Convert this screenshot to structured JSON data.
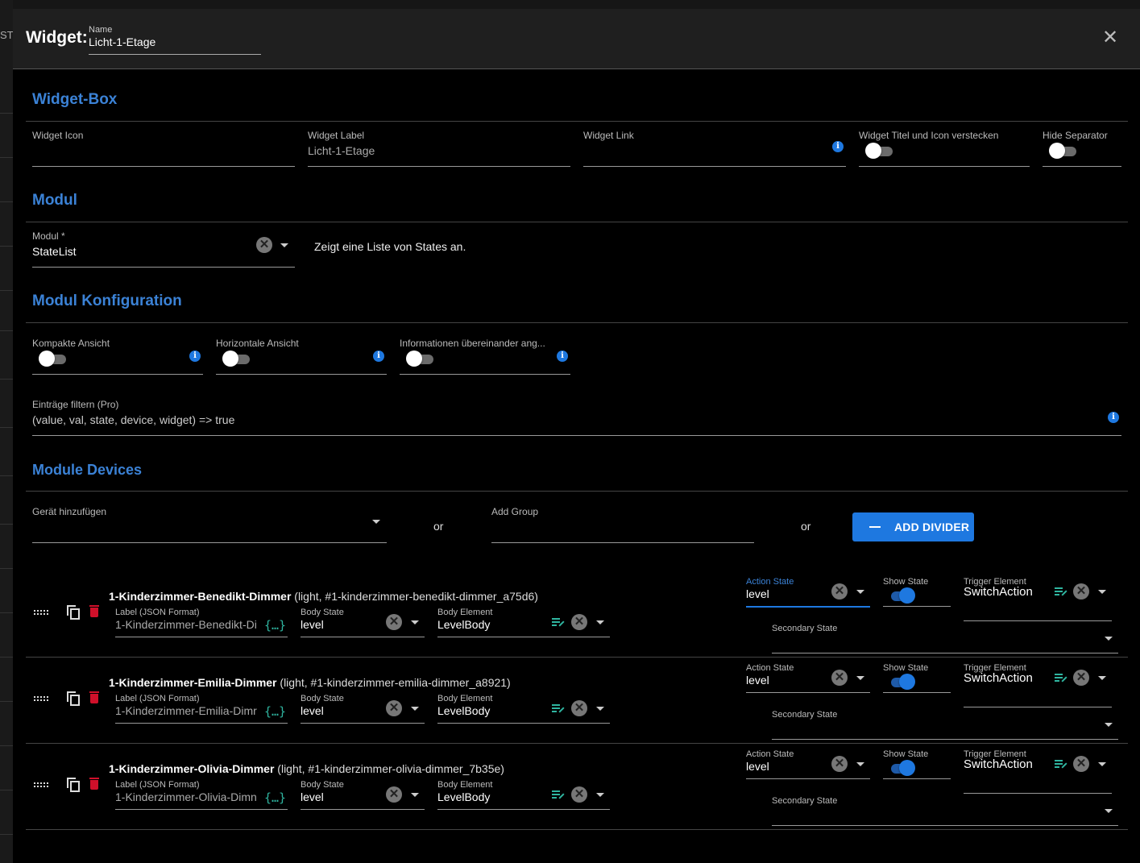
{
  "background": {
    "partial_text": "STY"
  },
  "dialog": {
    "title": "Widget:",
    "name_field": {
      "label": "Name",
      "value": "Licht-1-Etage"
    },
    "close_icon": "close-icon"
  },
  "sections": {
    "widget_box": {
      "title": "Widget-Box",
      "widget_icon": {
        "label": "Widget Icon",
        "value": ""
      },
      "widget_label": {
        "label": "Widget Label",
        "value": "Licht-1-Etage"
      },
      "widget_link": {
        "label": "Widget Link",
        "value": ""
      },
      "hide_title_icon": {
        "label": "Widget Titel und Icon verstecken",
        "checked": false
      },
      "hide_separator": {
        "label": "Hide Separator",
        "checked": false
      }
    },
    "modul": {
      "title": "Modul",
      "modul_select": {
        "label": "Modul *",
        "value": "StateList"
      },
      "description": "Zeigt eine Liste von States an."
    },
    "modul_config": {
      "title": "Modul Konfiguration",
      "kompakte": {
        "label": "Kompakte Ansicht",
        "checked": false
      },
      "horizontale": {
        "label": "Horizontale Ansicht",
        "checked": false
      },
      "informationen": {
        "label": "Informationen übereinander ang...",
        "checked": false
      },
      "filter": {
        "label": "Einträge filtern (Pro)",
        "value": "(value, val, state, device, widget) => true"
      }
    },
    "module_devices": {
      "title": "Module Devices",
      "add_device": {
        "label": "Gerät hinzufügen",
        "value": ""
      },
      "or_1": "or",
      "add_group": {
        "label": "Add Group",
        "value": ""
      },
      "or_2": "or",
      "add_divider_label": "ADD DIVIDER"
    }
  },
  "devices": [
    {
      "name": "1-Kinderzimmer-Benedikt-Dimmer",
      "meta": "(light, #1-kinderzimmer-benedikt-dimmer_a75d6)",
      "label_field": {
        "label": "Label (JSON Format)",
        "value": "1-Kinderzimmer-Benedikt-Di"
      },
      "body_state": {
        "label": "Body State",
        "value": "level"
      },
      "body_element": {
        "label": "Body Element",
        "value": "LevelBody"
      },
      "action_state": {
        "label": "Action State",
        "value": "level"
      },
      "show_state": {
        "label": "Show State",
        "checked": true
      },
      "trigger_element": {
        "label": "Trigger Element",
        "value": "SwitchAction"
      },
      "secondary_state": {
        "label": "Secondary State",
        "value": ""
      }
    },
    {
      "name": "1-Kinderzimmer-Emilia-Dimmer",
      "meta": "(light, #1-kinderzimmer-emilia-dimmer_a8921)",
      "label_field": {
        "label": "Label (JSON Format)",
        "value": "1-Kinderzimmer-Emilia-Dimr"
      },
      "body_state": {
        "label": "Body State",
        "value": "level"
      },
      "body_element": {
        "label": "Body Element",
        "value": "LevelBody"
      },
      "action_state": {
        "label": "Action State",
        "value": "level"
      },
      "show_state": {
        "label": "Show State",
        "checked": true
      },
      "trigger_element": {
        "label": "Trigger Element",
        "value": "SwitchAction"
      },
      "secondary_state": {
        "label": "Secondary State",
        "value": ""
      }
    },
    {
      "name": "1-Kinderzimmer-Olivia-Dimmer",
      "meta": "(light, #1-kinderzimmer-olivia-dimmer_7b35e)",
      "label_field": {
        "label": "Label (JSON Format)",
        "value": "1-Kinderzimmer-Olivia-Dimn"
      },
      "body_state": {
        "label": "Body State",
        "value": "level"
      },
      "body_element": {
        "label": "Body Element",
        "value": "LevelBody"
      },
      "action_state": {
        "label": "Action State",
        "value": "level"
      },
      "show_state": {
        "label": "Show State",
        "checked": true
      },
      "trigger_element": {
        "label": "Trigger Element",
        "value": "SwitchAction"
      },
      "secondary_state": {
        "label": "Secondary State",
        "value": ""
      }
    }
  ],
  "colors": {
    "accent": "#1e78e0",
    "section_title": "#3b82d6",
    "json_icon": "#2fb5a0",
    "delete": "#d0102a"
  }
}
